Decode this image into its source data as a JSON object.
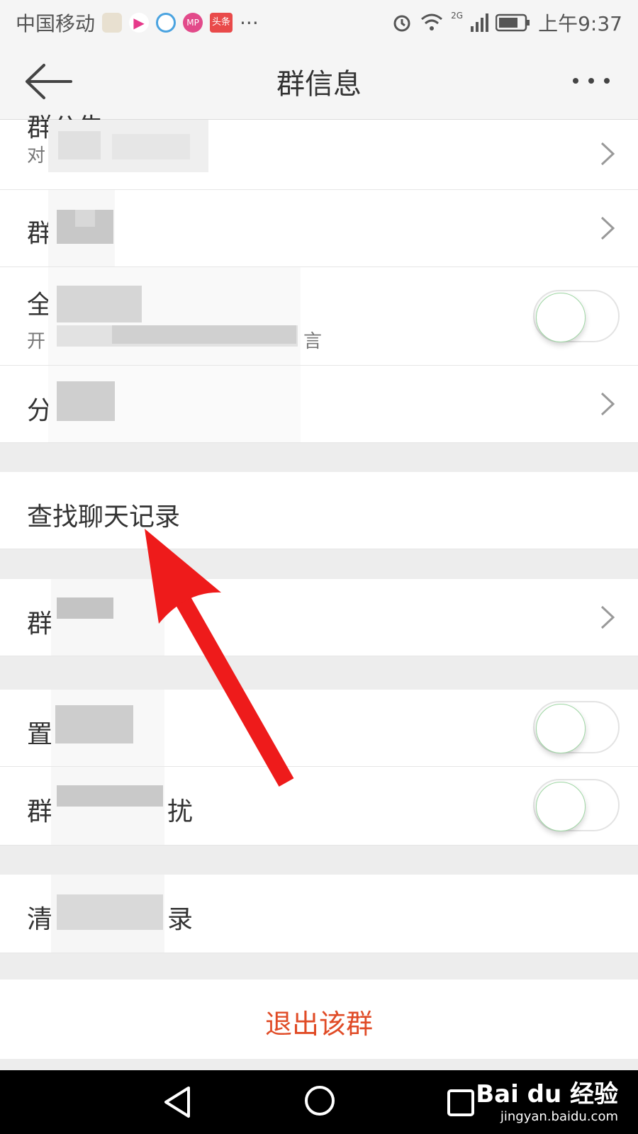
{
  "status_bar": {
    "carrier": "中国移动",
    "apps": [
      "shield",
      "youku",
      "browser",
      "MP",
      "头条"
    ],
    "more": "···",
    "network": "2G",
    "time": "上午9:37"
  },
  "header": {
    "title": "群信息"
  },
  "rows": {
    "announcement_title_partial": "群公告",
    "announcement_sub_partial": "对",
    "row2_partial": "群",
    "mute_all_partial": "全",
    "mute_all_sub_start": "开",
    "mute_all_sub_end": "言",
    "row4_partial": "分",
    "search_history": "查找聊天记录",
    "row6_partial": "群",
    "pin_partial": "置",
    "dnd_partial_start": "群",
    "dnd_partial_end": "扰",
    "clear_partial_start": "清",
    "clear_partial_end": "录",
    "exit_group": "退出该群"
  },
  "toggles": {
    "mute_all": false,
    "pin_chat": false,
    "do_not_disturb": false
  },
  "watermark": {
    "logo": "Bai du 经验",
    "url": "jingyan.baidu.com"
  },
  "colors": {
    "accent_red": "#e04b26",
    "arrow_red": "#ee1b1b",
    "toggle_green": "#9fd7a4"
  }
}
